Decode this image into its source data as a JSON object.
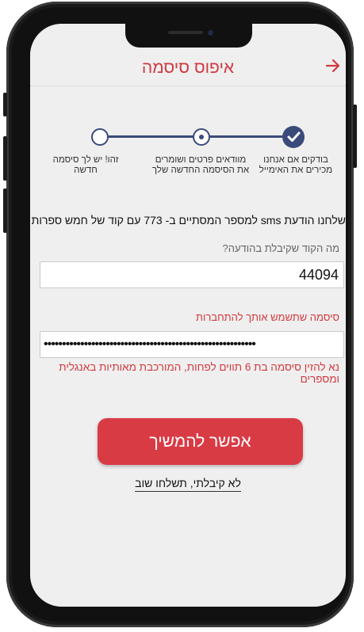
{
  "header": {
    "title": "איפוס סיסמה",
    "back_icon": "arrow-right-icon",
    "accent_color": "#d03a40"
  },
  "stepper": {
    "steps": [
      {
        "label": "בודקים אם אנחנו מכירים את האימייל",
        "state": "done"
      },
      {
        "label": "מוודאים פרטים ושומרים את הסיסמה החדשה שלך",
        "state": "current"
      },
      {
        "label": "זהו! יש לך סיסמה חדשה",
        "state": "todo"
      }
    ],
    "active_color": "#3a4a7a"
  },
  "info_text": "שלחנו הודעת sms למספר המסתיים ב- 773 עם קוד של חמש ספרות",
  "code_field": {
    "label": "מה הקוד שקיבלת בהודעה?",
    "value": "44094"
  },
  "password_field": {
    "label": "סיסמה שתשמש אותך להתחברות",
    "value": "••••••••••••••••••••••••••••••••••••••••••••••••••••••••••"
  },
  "password_hint": "נא להזין סיסמה בת 6 תווים לפחות, המורכבת מאותיות באנגלית ומספרים",
  "continue_button": {
    "label": "אפשר להמשיך",
    "color": "#d93b45"
  },
  "resend_link": "לא קיבלתי, תשלחו שוב"
}
